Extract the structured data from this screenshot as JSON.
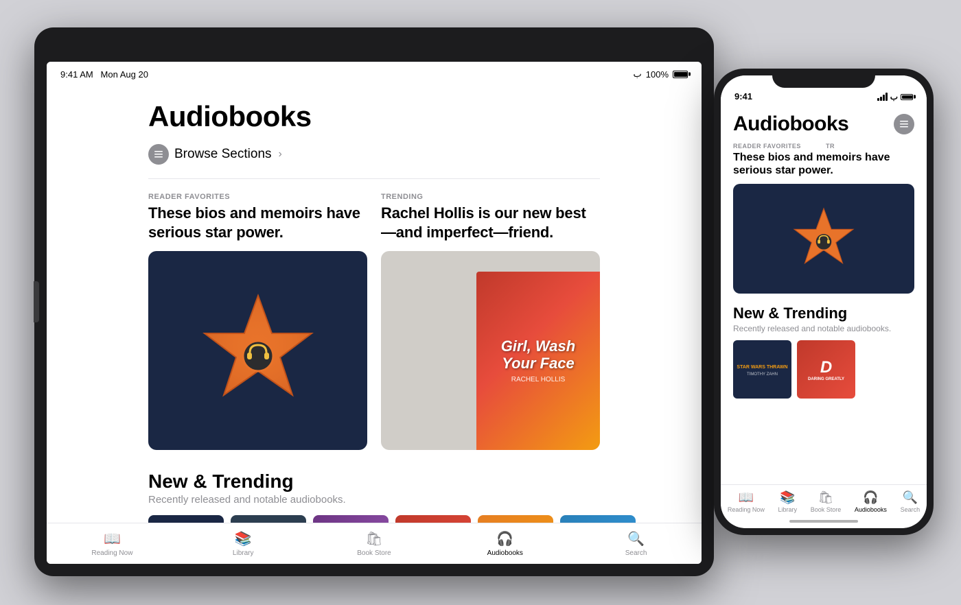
{
  "scene": {
    "background_color": "#d1d1d6"
  },
  "ipad": {
    "status_bar": {
      "time": "9:41 AM",
      "date": "Mon Aug 20",
      "wifi": "WiFi",
      "battery_percent": "100%"
    },
    "content": {
      "page_title": "Audiobooks",
      "browse_sections_label": "Browse Sections",
      "section1": {
        "category": "READER FAVORITES",
        "headline": "These bios and memoirs have serious star power."
      },
      "section2": {
        "category": "TRENDING",
        "headline": "Rachel Hollis is our new best—and imperfect—friend."
      },
      "new_trending": {
        "title": "New & Trending",
        "subtitle": "Recently released and notable audiobooks."
      }
    },
    "tab_bar": {
      "items": [
        {
          "label": "Reading Now",
          "icon": "📖"
        },
        {
          "label": "Library",
          "icon": "📚"
        },
        {
          "label": "Book Store",
          "icon": "🛍"
        },
        {
          "label": "Audiobooks",
          "icon": "🎧",
          "active": true
        },
        {
          "label": "Search",
          "icon": "🔍"
        }
      ]
    }
  },
  "iphone": {
    "status_bar": {
      "time": "9:41",
      "battery": "100%"
    },
    "content": {
      "page_title": "Audiobooks",
      "section1_category": "READER FAVORITES",
      "section1_headline": "These bios and memoirs have serious star power.",
      "trending_label": "TR",
      "new_trending_title": "New & Trending",
      "new_trending_subtitle": "Recently released and notable audiobooks."
    },
    "tab_bar": {
      "items": [
        {
          "label": "Reading Now",
          "active": false
        },
        {
          "label": "Library",
          "active": false
        },
        {
          "label": "Book Store",
          "active": false
        },
        {
          "label": "Audiobooks",
          "active": true
        },
        {
          "label": "Search",
          "active": false
        }
      ]
    }
  }
}
